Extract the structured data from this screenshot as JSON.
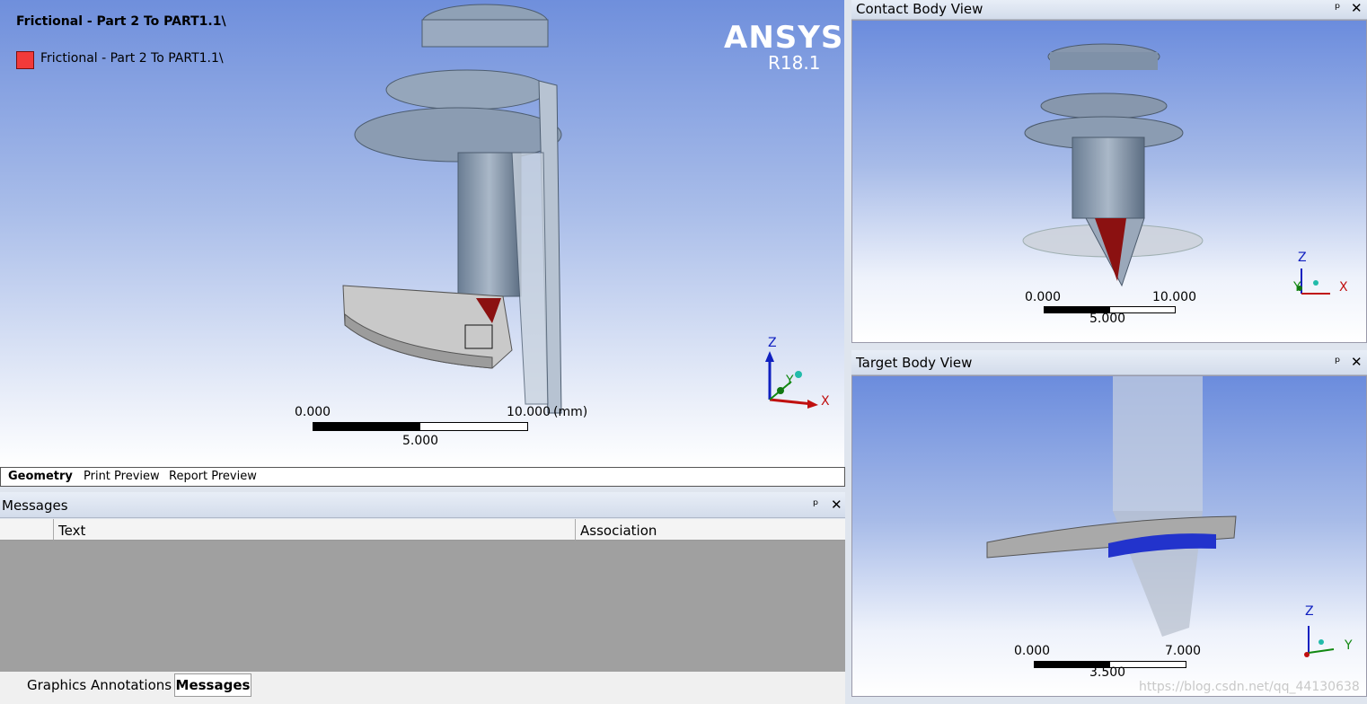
{
  "main_view": {
    "title": "Frictional - Part 2 To PART1.1\\",
    "legend": {
      "label": "Frictional - Part 2 To PART1.1\\",
      "color": "#f23a3a"
    },
    "brand": "ANSYS",
    "version": "R18.1",
    "scale": {
      "start": "0.000",
      "mid": "5.000",
      "end": "10.000",
      "unit": "(mm)"
    },
    "triad": {
      "z": "Z",
      "y": "Y",
      "x": "X"
    }
  },
  "view_tabs": [
    "Geometry",
    "Print Preview",
    "Report Preview"
  ],
  "messages": {
    "title": "Messages",
    "pin": "ᵖ",
    "close": "✕",
    "columns": [
      "Text",
      "Association"
    ]
  },
  "bottom_tabs": [
    "Graphics Annotations",
    "Messages"
  ],
  "contact_view": {
    "title": "Contact Body View",
    "scale": {
      "start": "0.000",
      "mid": "5.000",
      "end": "10.000"
    },
    "triad": {
      "z": "Z",
      "y": "Y",
      "x": "X"
    }
  },
  "target_view": {
    "title": "Target Body View",
    "scale": {
      "start": "0.000",
      "mid": "3.500",
      "end": "7.000"
    },
    "triad": {
      "z": "Z",
      "y": "Y"
    }
  },
  "panel_controls": {
    "pin": "ᵖ",
    "close": "✕"
  },
  "watermark": "https://blog.csdn.net/qq_44130638",
  "colors": {
    "contact": "#f23a3a",
    "target": "#2233cc",
    "accent": "#6f8fdc"
  }
}
